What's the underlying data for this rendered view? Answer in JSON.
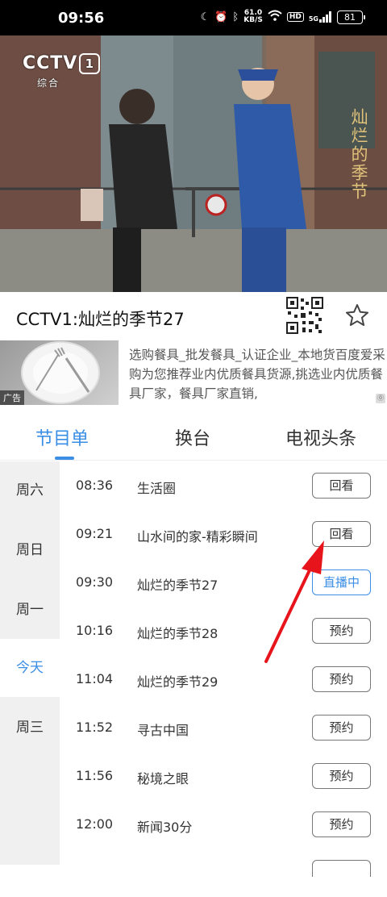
{
  "status_bar": {
    "time": "09:56",
    "net_speed_value": "61.0",
    "net_speed_unit": "KB/S",
    "hd": "HD",
    "signal": "5G",
    "battery": "81"
  },
  "video": {
    "channel_logo": "CCTV",
    "channel_number": "1",
    "channel_sub": "综合",
    "overlay_title": "灿烂的季节"
  },
  "header": {
    "title": "CCTV1:灿烂的季节27"
  },
  "ad": {
    "tag": "广告",
    "text": "选购餐具_批发餐具_认证企业_本地货百度爱采购为您推荐业内优质餐具货源,挑选业内优质餐具厂家，餐具厂家直销,"
  },
  "tabs": [
    "节目单",
    "换台",
    "电视头条"
  ],
  "days": [
    "周六",
    "周日",
    "周一",
    "今天",
    "周三"
  ],
  "programs": [
    {
      "time": "08:36",
      "name": "生活圈",
      "action": "回看"
    },
    {
      "time": "09:21",
      "name": "山水间的家-精彩瞬间",
      "action": "回看"
    },
    {
      "time": "09:30",
      "name": "灿烂的季节27",
      "action": "直播中"
    },
    {
      "time": "10:16",
      "name": "灿烂的季节28",
      "action": "预约"
    },
    {
      "time": "11:04",
      "name": "灿烂的季节29",
      "action": "预约"
    },
    {
      "time": "11:52",
      "name": "寻古中国",
      "action": "预约"
    },
    {
      "time": "11:56",
      "name": "秘境之眼",
      "action": "预约"
    },
    {
      "time": "12:00",
      "name": "新闻30分",
      "action": "预约"
    }
  ],
  "colors": {
    "accent": "#3a8ee6",
    "arrow": "#e8141c"
  }
}
